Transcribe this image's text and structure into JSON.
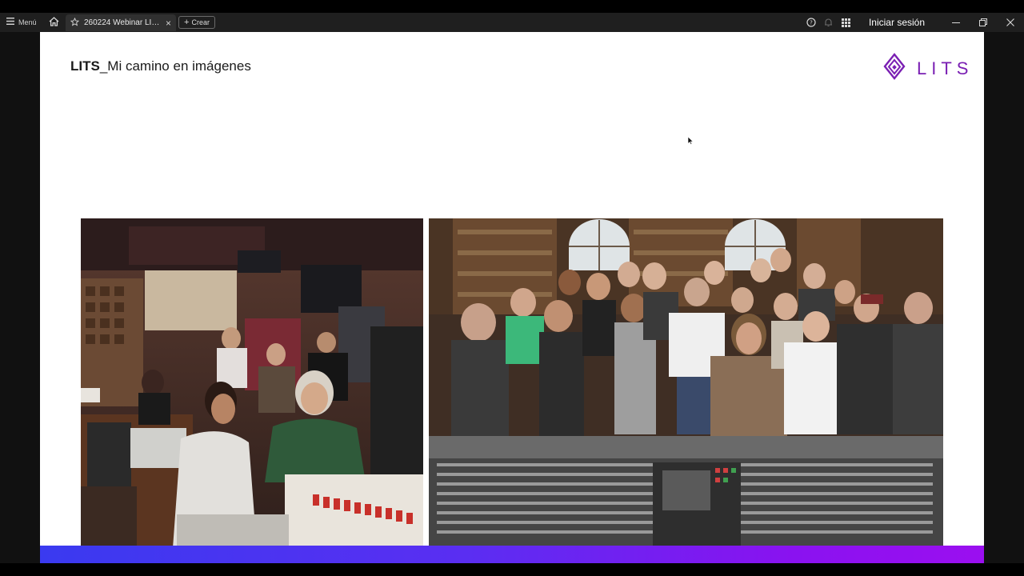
{
  "toolbar": {
    "menu_label": "Menú",
    "tab_title": "260224 Webinar LIT...",
    "create_label": "Crear",
    "signin_label": "Iniciar sesión"
  },
  "slide": {
    "title_bold": "LITS",
    "title_rest": "_Mi camino en imágenes",
    "logo_text": "LITS",
    "logo_color": "#7a1fb3"
  },
  "images": {
    "left_photo": "recording-studio-session-photo",
    "right_photo": "group-photo-at-mixing-console"
  },
  "colors": {
    "accent_gradient_start": "#3a3af0",
    "accent_gradient_end": "#9b0ff0",
    "toolbar_bg": "#1f1f1f"
  }
}
